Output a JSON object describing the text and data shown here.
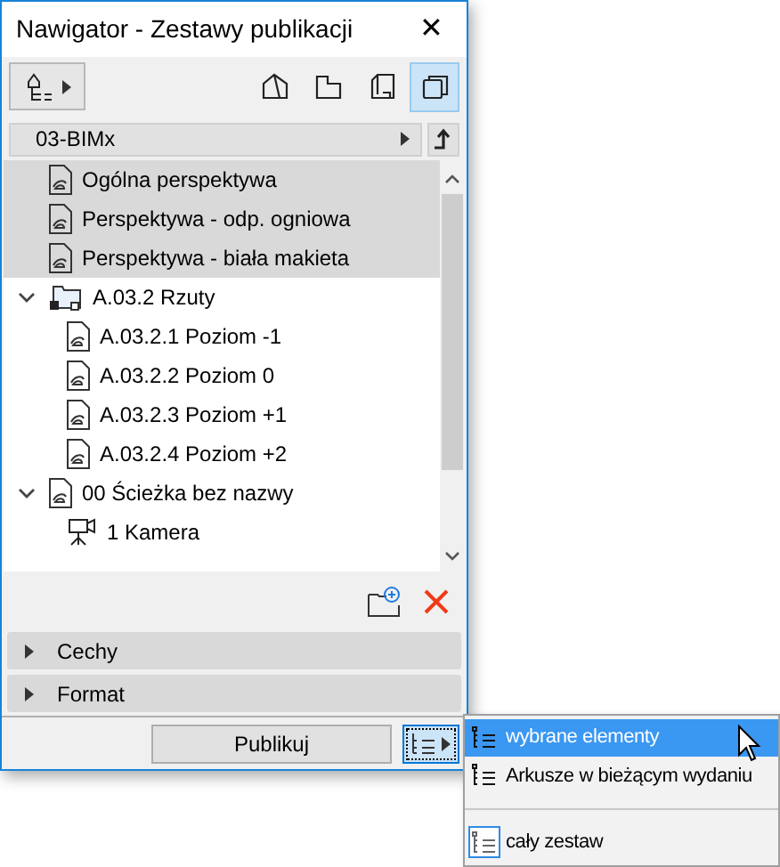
{
  "window": {
    "title": "Nawigator - Zestawy publikacji",
    "close": "✕"
  },
  "toolbar": {
    "modes": [
      {
        "kind": "house",
        "selected": false
      },
      {
        "kind": "plan",
        "selected": false
      },
      {
        "kind": "layout",
        "selected": false
      },
      {
        "kind": "sets",
        "selected": true
      }
    ]
  },
  "path": {
    "label": "03-BIMx"
  },
  "tree": [
    {
      "label": "Ogólna perspektywa",
      "kind": "view",
      "selected": true
    },
    {
      "label": "Perspektywa - odp. ogniowa",
      "kind": "view",
      "selected": true
    },
    {
      "label": "Perspektywa - biała makieta",
      "kind": "view",
      "selected": true
    },
    {
      "label": "A.03.2 Rzuty",
      "kind": "folder",
      "selected": false,
      "expanded": true,
      "children": [
        {
          "label": "A.03.2.1 Poziom -1",
          "kind": "view",
          "selected": false
        },
        {
          "label": "A.03.2.2 Poziom 0",
          "kind": "view",
          "selected": false
        },
        {
          "label": "A.03.2.3 Poziom +1",
          "kind": "view",
          "selected": false
        },
        {
          "label": "A.03.2.4 Poziom +2",
          "kind": "view",
          "selected": false
        }
      ]
    },
    {
      "label": "00 Ścieżka bez nazwy",
      "kind": "view",
      "selected": false,
      "expanded": true,
      "children": [
        {
          "label": "1 Kamera",
          "kind": "camera",
          "selected": false
        }
      ]
    }
  ],
  "panels": [
    {
      "label": "Cechy",
      "expanded": false
    },
    {
      "label": "Format",
      "expanded": false
    }
  ],
  "publish_button": "Publikuj",
  "menu": [
    {
      "label": "wybrane elementy",
      "highlighted": true,
      "checked": false
    },
    {
      "label": "Arkusze w bieżącym wydaniu",
      "highlighted": false,
      "checked": false
    },
    {
      "kind": "separator"
    },
    {
      "label": "cały zestaw",
      "highlighted": false,
      "checked": true
    }
  ]
}
